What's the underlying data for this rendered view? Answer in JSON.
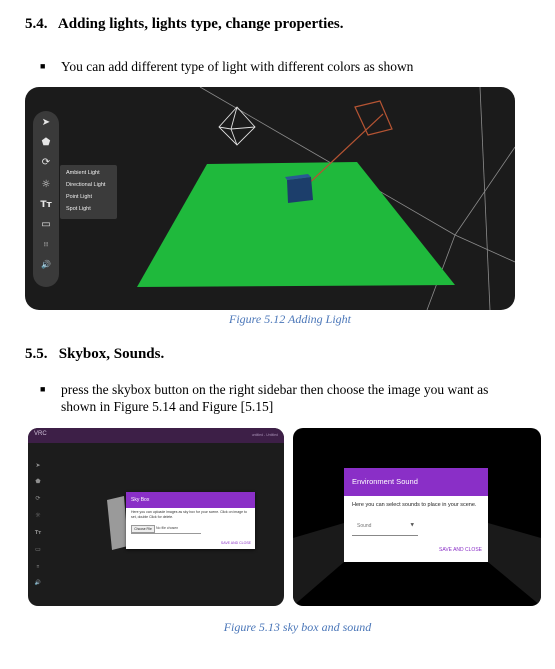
{
  "section_54": {
    "heading": "5.4.   Adding lights, lights type, change properties.",
    "bullet": "You can add different type of light with different colors as shown"
  },
  "figure_512": {
    "toolbar_icons": [
      "send-icon",
      "shapes-icon",
      "rotate-icon",
      "sun-icon",
      "text-icon",
      "frame-icon",
      "equalizer-icon",
      "speaker-icon"
    ],
    "toolbar_glyphs": [
      "➤",
      "⬟",
      "⟳",
      "☼",
      "Tт",
      "▭",
      "⦙⦙⦙",
      "🔊"
    ],
    "light_menu": [
      "Ambient Light",
      "Directional Light",
      "Point Light",
      "Spot Light"
    ],
    "colors": {
      "floor": "#1fb93c",
      "cube": "#1c3e6b",
      "helper_line": "#b55433"
    },
    "caption": "Figure 5.12 Adding Light"
  },
  "section_55": {
    "heading": "5.5.   Skybox, Sounds.",
    "bullet": "press the skybox button on the right sidebar then choose the image you want as shown in Figure 5.14 and Figure [5.15]"
  },
  "figure_513": {
    "left": {
      "app_label": "VRC",
      "topbar_right": "untitled - Untitled",
      "dialog_title": "Sky Box",
      "dialog_text": "Here you can uploade images as sky box for your scene. Click on image to set, double Click for delete.",
      "file_button": "Choose File",
      "file_status": "No file chosen",
      "save_label": "SAVE AND CLOSE"
    },
    "right": {
      "dialog_title": "Environment Sound",
      "dialog_text": "Here you can select sounds to place in your scene.",
      "select_value": "Sound",
      "save_label": "SAVE AND CLOSE"
    },
    "colors": {
      "accent": "#8a2fc7",
      "topbar": "#3d1f47"
    },
    "caption": "Figure 5.13 sky box and sound"
  }
}
